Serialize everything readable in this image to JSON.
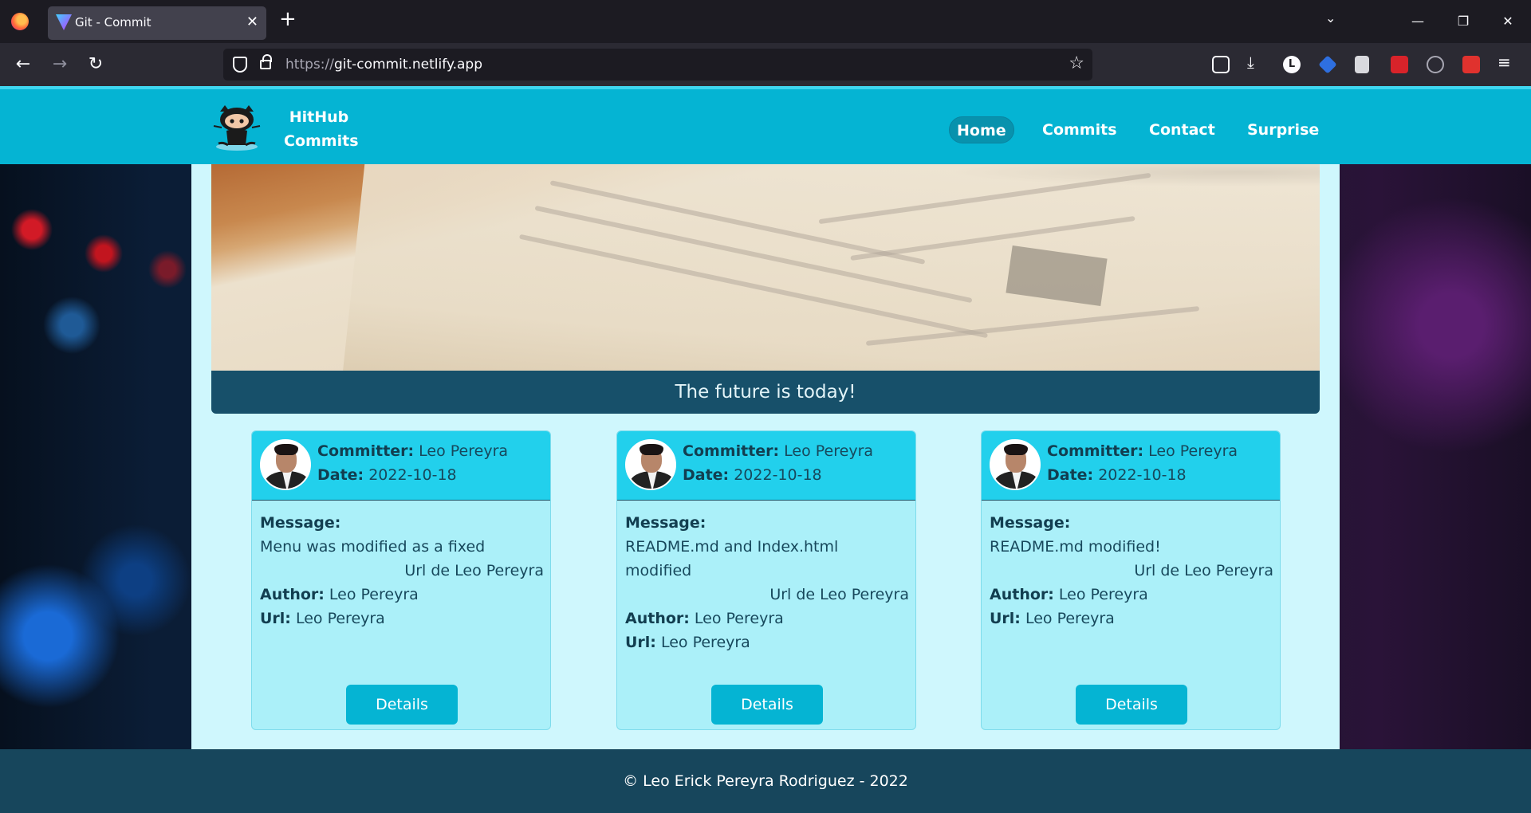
{
  "browser": {
    "tab_title": "Git - Commit",
    "tab_close": "✕",
    "new_tab": "+",
    "url_protocol": "https://",
    "url_host": "git-commit.netlify.app",
    "window_minimize": "—",
    "window_restore": "❐",
    "window_close": "✕",
    "toolbar_icons": [
      "pocket-icon",
      "downloads-icon",
      "extension-l-icon",
      "extension-blue-icon",
      "reader-icon",
      "extension-red-icon",
      "extension-info-icon",
      "extension-m-icon",
      "menu-icon"
    ]
  },
  "header": {
    "brand_line1": "HitHub",
    "brand_line2": "Commits",
    "menu": [
      {
        "label": "Home",
        "active": true
      },
      {
        "label": "Commits",
        "active": false
      },
      {
        "label": "Contact",
        "active": false
      },
      {
        "label": "Surprise",
        "active": false
      }
    ]
  },
  "hero": {
    "caption": "The future is today!"
  },
  "cards": [
    {
      "committer_label": "Committer:",
      "committer": "Leo Pereyra",
      "date_label": "Date:",
      "date": "2022-10-18",
      "message_label": "Message:",
      "message": "Menu was modified as a fixed",
      "url_link": "Url de Leo Pereyra",
      "author_label": "Author:",
      "author": "Leo Pereyra",
      "url_label": "Url:",
      "url": "Leo Pereyra",
      "button": "Details"
    },
    {
      "committer_label": "Committer:",
      "committer": "Leo Pereyra",
      "date_label": "Date:",
      "date": "2022-10-18",
      "message_label": "Message:",
      "message": "README.md and Index.html modified",
      "url_link": "Url de Leo Pereyra",
      "author_label": "Author:",
      "author": "Leo Pereyra",
      "url_label": "Url:",
      "url": "Leo Pereyra",
      "button": "Details"
    },
    {
      "committer_label": "Committer:",
      "committer": "Leo Pereyra",
      "date_label": "Date:",
      "date": "2022-10-18",
      "message_label": "Message:",
      "message": "README.md modified!",
      "url_link": "Url de Leo Pereyra",
      "author_label": "Author:",
      "author": "Leo Pereyra",
      "url_label": "Url:",
      "url": "Leo Pereyra",
      "button": "Details"
    }
  ],
  "footer": {
    "text": "© Leo Erick Pereyra Rodriguez - 2022"
  },
  "colors": {
    "header_bg": "#05b4d3",
    "caption_bg": "#17506a",
    "card_head_bg": "#22d0ec",
    "card_bg": "#abf0f9",
    "footer_bg": "#17465c"
  }
}
